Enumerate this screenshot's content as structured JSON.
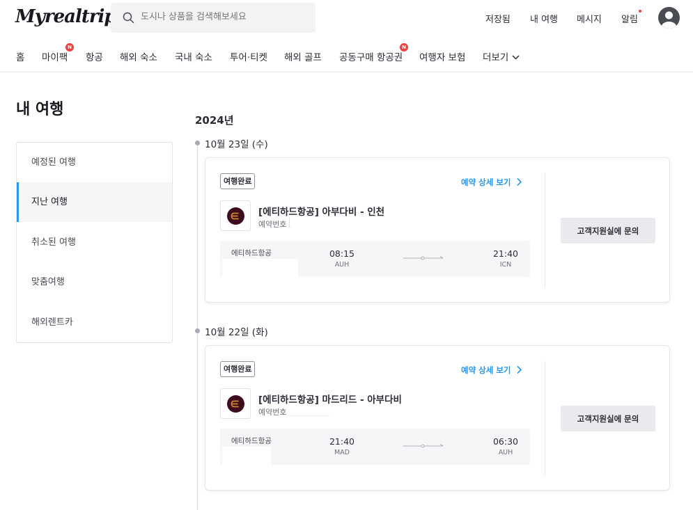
{
  "header": {
    "logo": "Myrealtrip",
    "search": {
      "placeholder": "도시나 상품을 검색해보세요"
    },
    "links": [
      "저장됨",
      "내 여행",
      "메시지",
      "알림"
    ]
  },
  "nav": {
    "items": [
      "홈",
      "마이팩",
      "항공",
      "해외 숙소",
      "국내 숙소",
      "투어·티켓",
      "해외 골프",
      "공동구매 항공권",
      "여행자 보험",
      "더보기"
    ],
    "badge": "N"
  },
  "page": {
    "title": "내 여행"
  },
  "sidebar": {
    "items": [
      {
        "label": "예정된 여행"
      },
      {
        "label": "지난 여행",
        "active": true
      },
      {
        "label": "취소된 여행"
      },
      {
        "label": "맞춤여행"
      },
      {
        "label": "해외렌트카"
      }
    ]
  },
  "timeline": {
    "year": "2024년",
    "groups": [
      {
        "date": "10월 23일 (수)",
        "card": {
          "status": "여행완료",
          "detail_link": "예약 상세 보기",
          "title": "[에티하드항공] 아부다비 - 인천",
          "reservation_label": "예약번호",
          "airline": "에티하드항공",
          "dep_time": "08:15",
          "dep_code": "AUH",
          "arr_time": "21:40",
          "arr_code": "ICN",
          "support_button": "고객지원실에 문의"
        }
      },
      {
        "date": "10월 22일 (화)",
        "card": {
          "status": "여행완료",
          "detail_link": "예약 상세 보기",
          "title": "[에티하드항공] 마드리드 - 아부다비",
          "reservation_label": "예약번호",
          "airline": "에티하드항공",
          "dep_time": "21:40",
          "dep_code": "MAD",
          "arr_time": "06:30",
          "arr_code": "AUH",
          "support_button": "고객지원실에 문의"
        }
      }
    ]
  },
  "colors": {
    "accent": "#2b96ed",
    "badge_red": "#f0423f",
    "etihad": "#3d0c1e",
    "etihad_gold": "#c9872a"
  }
}
